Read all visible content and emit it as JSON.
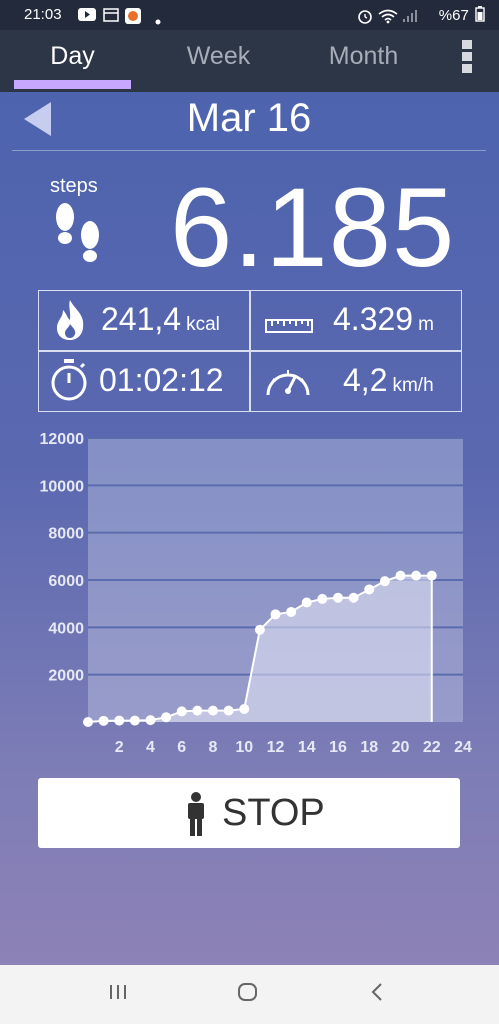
{
  "status_bar": {
    "time": "21:03",
    "battery": "%67"
  },
  "tabs": [
    {
      "label": "Day",
      "active": true
    },
    {
      "label": "Week"
    },
    {
      "label": "Month"
    }
  ],
  "date": "Mar 16",
  "steps": {
    "label": "steps",
    "value": "6.185"
  },
  "stats": {
    "calories": {
      "value": "241,4",
      "unit": "kcal"
    },
    "distance": {
      "value": "4.329",
      "unit": "m"
    },
    "duration": {
      "value": "01:02:12"
    },
    "speed": {
      "value": "4,2",
      "unit": "km/h"
    }
  },
  "chart_data": {
    "type": "area",
    "ylim": [
      0,
      12000
    ],
    "xlim": [
      0,
      24
    ],
    "yticks": [
      2000,
      4000,
      6000,
      8000,
      10000,
      12000
    ],
    "xticks": [
      2,
      4,
      6,
      8,
      10,
      12,
      14,
      16,
      18,
      20,
      22,
      24
    ],
    "grid": true,
    "x": [
      0,
      1,
      2,
      3,
      4,
      5,
      6,
      7,
      8,
      9,
      10,
      11,
      12,
      13,
      14,
      15,
      16,
      17,
      18,
      19,
      20,
      21,
      22
    ],
    "values": [
      0,
      50,
      60,
      60,
      80,
      200,
      450,
      480,
      480,
      480,
      550,
      3900,
      4550,
      4650,
      5050,
      5200,
      5250,
      5250,
      5600,
      5950,
      6185,
      6185,
      6185
    ]
  },
  "stop_button": {
    "label": "STOP"
  },
  "colors": {
    "tab_indicator": "#c8a7ff",
    "tabbar_bg": "#2d3646",
    "statusbar_bg": "#232a3c"
  }
}
